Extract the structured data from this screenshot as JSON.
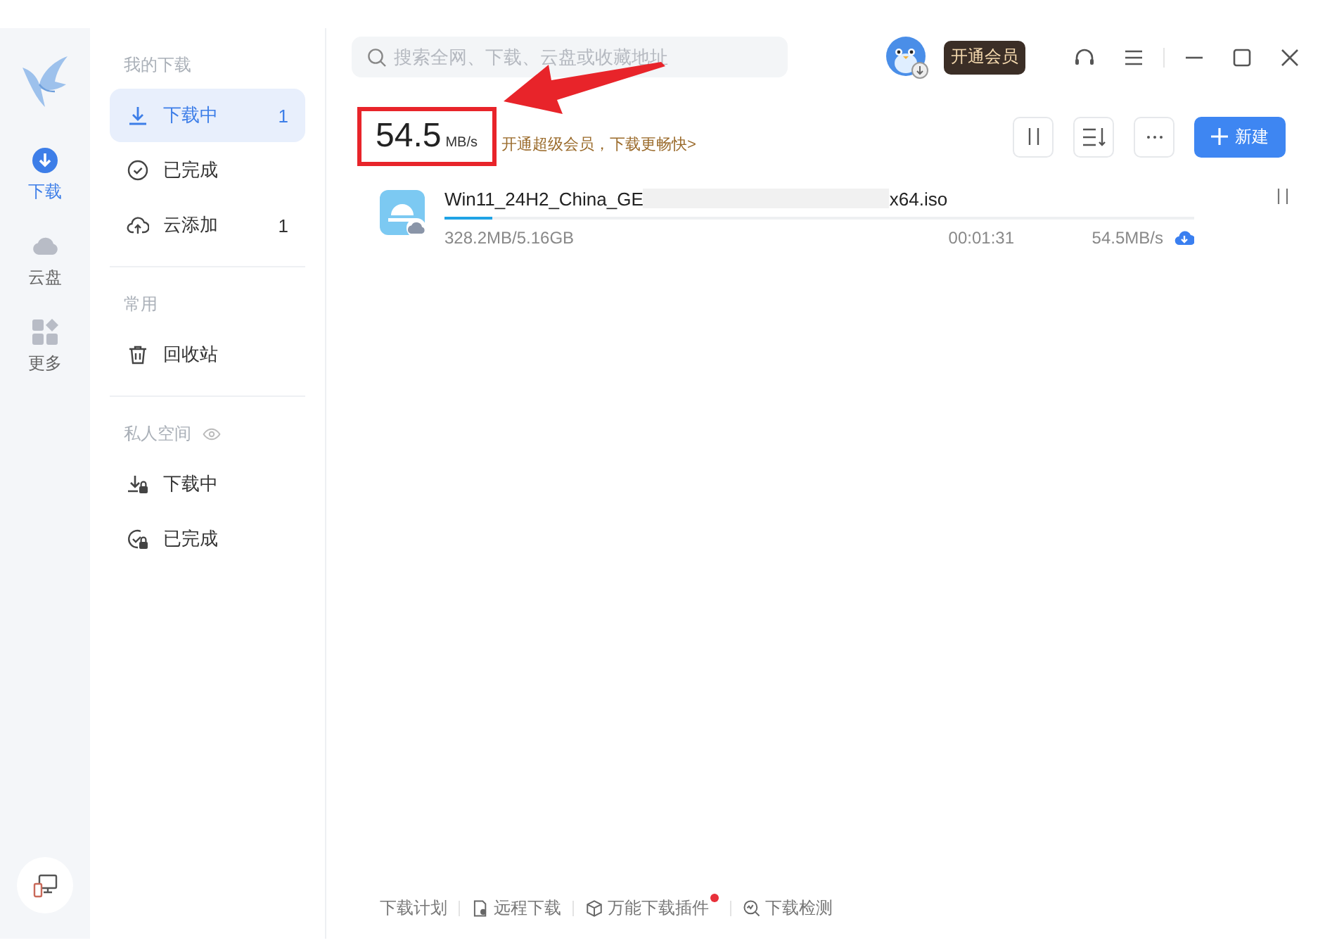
{
  "nav": [
    {
      "label": "下载",
      "kind": "download",
      "selected": true
    },
    {
      "label": "云盘",
      "kind": "cloud",
      "selected": false
    },
    {
      "label": "更多",
      "kind": "more",
      "selected": false
    }
  ],
  "sidebar": {
    "sections": [
      {
        "title": "我的下载",
        "kind": "public",
        "items": [
          {
            "label": "下载中",
            "kind": "downloading",
            "count": "1",
            "selected": true
          },
          {
            "label": "已完成",
            "kind": "completed",
            "selected": false
          },
          {
            "label": "云添加",
            "kind": "cloud-add",
            "count": "1",
            "selected": false
          }
        ]
      },
      {
        "title": "常用",
        "kind": "public",
        "items": [
          {
            "label": "回收站",
            "kind": "trash",
            "selected": false
          }
        ]
      },
      {
        "title": "私人空间",
        "kind": "private",
        "items": [
          {
            "label": "下载中",
            "kind": "private-downloading",
            "selected": false
          },
          {
            "label": "已完成",
            "kind": "private-completed",
            "selected": false
          }
        ]
      }
    ]
  },
  "search": {
    "placeholder": "搜索全网、下载、云盘或收藏地址"
  },
  "vip_button": "开通会员",
  "speed": {
    "value": "54.5",
    "unit": "MB/s",
    "highlighted": true
  },
  "promo_link": "开通超级会员，下载更畅快>",
  "new_button": "新建",
  "tasks": [
    {
      "name_start": "Win11_24H2_China_GE",
      "name_end": "x64.iso",
      "level": 0.064,
      "size": "328.2MB/5.16GB",
      "time_left": "00:01:31",
      "speed": "54.5MB/s"
    }
  ],
  "footer": [
    {
      "label": "下载计划",
      "kind": "plan",
      "badge": false
    },
    {
      "label": "远程下载",
      "kind": "remote",
      "badge": false
    },
    {
      "label": "万能下载插件",
      "kind": "plugin",
      "badge": true
    },
    {
      "label": "下载检测",
      "kind": "detect",
      "badge": false
    }
  ]
}
